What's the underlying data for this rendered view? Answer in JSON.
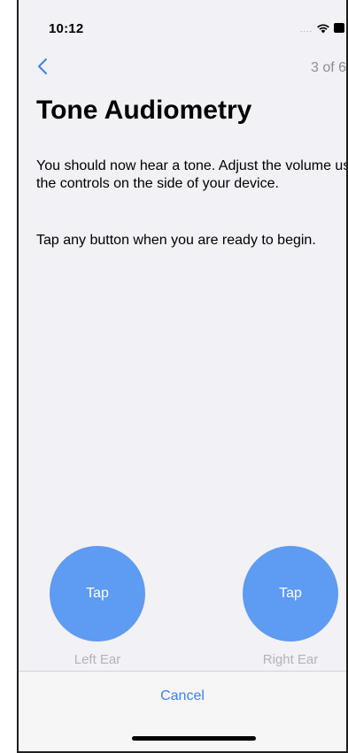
{
  "status_bar": {
    "time": "10:12",
    "signal": "....",
    "wifi_icon": "wifi-icon",
    "battery_icon": "battery-icon"
  },
  "nav": {
    "back_icon": "chevron-left-icon",
    "step_counter": "3 of 6"
  },
  "page": {
    "title": "Tone Audiometry",
    "instruction_1": "You should now hear a tone. Adjust the volume using the controls on the side of your device.",
    "instruction_2": "Tap any button when you are ready to begin."
  },
  "buttons": {
    "left": {
      "label": "Tap",
      "caption": "Left Ear"
    },
    "right": {
      "label": "Tap",
      "caption": "Right Ear"
    }
  },
  "footer": {
    "cancel_label": "Cancel"
  },
  "colors": {
    "accent": "#3b82f0",
    "tap_button": "#5e9bf2",
    "background": "#f2f1f6"
  }
}
